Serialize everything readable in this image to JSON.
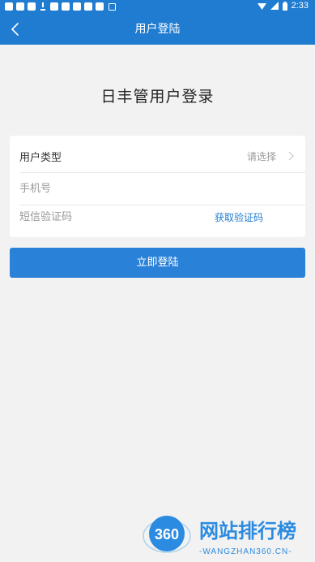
{
  "status_bar": {
    "time": "2:33"
  },
  "header": {
    "title": "用户登陆"
  },
  "page": {
    "title": "日丰管用户登录"
  },
  "form": {
    "user_type": {
      "label": "用户类型",
      "value": "请选择"
    },
    "phone": {
      "placeholder": "手机号"
    },
    "sms_code": {
      "placeholder": "短信验证码",
      "get_code_label": "获取验证码"
    }
  },
  "submit": {
    "label": "立即登陆"
  },
  "watermark": {
    "logo_number": "360",
    "name": "网站排行榜",
    "url": "-WANGZHAN360.CN-"
  },
  "colors": {
    "primary": "#1f7cd1",
    "button": "#2a82d8",
    "background": "#f2f2f2"
  }
}
